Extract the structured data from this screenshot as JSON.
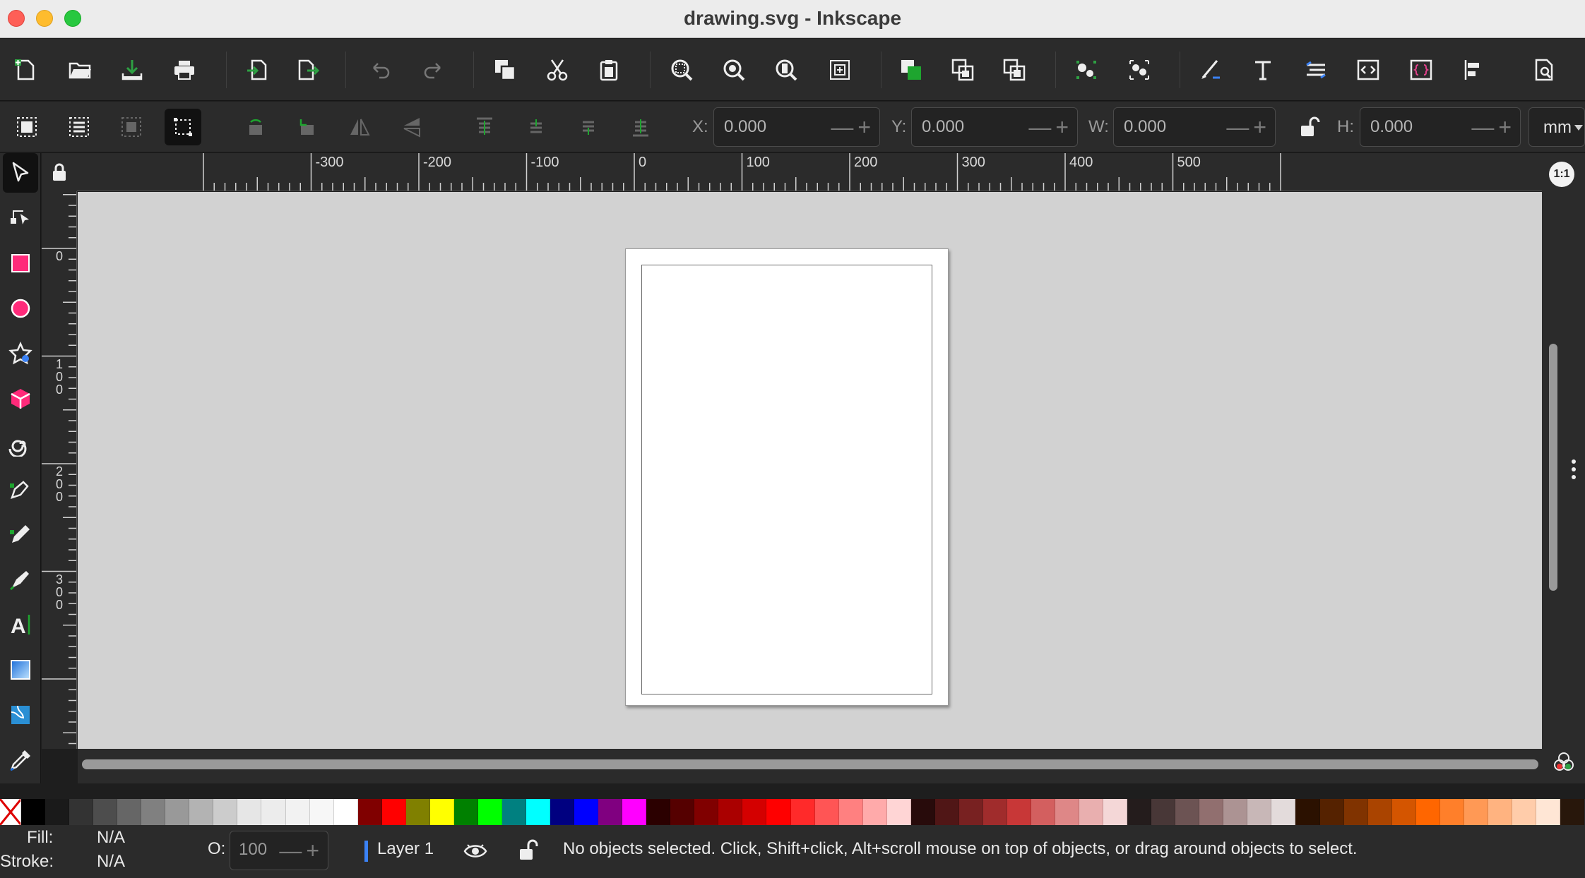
{
  "window": {
    "title": "drawing.svg - Inkscape"
  },
  "commands": [
    "new-document-icon",
    "open-document-icon",
    "save-document-icon",
    "print-icon",
    "import-icon",
    "export-icon",
    "undo-icon",
    "redo-icon",
    "duplicate-icon",
    "cut-icon",
    "paste-icon",
    "zoom-selection-icon",
    "zoom-drawing-icon",
    "zoom-page-icon",
    "zoom-page-width-icon",
    "raise-icon",
    "group-icon",
    "ungroup-icon",
    "clone-icon",
    "unlink-clone-icon",
    "fill-stroke-icon",
    "text-font-icon",
    "layers-icon",
    "xml-editor-icon",
    "object-properties-icon",
    "align-distribute-icon",
    "document-properties-icon"
  ],
  "toolcontrols": {
    "x": {
      "label": "X:",
      "value": "0.000"
    },
    "y": {
      "label": "Y:",
      "value": "0.000"
    },
    "w": {
      "label": "W:",
      "value": "0.000"
    },
    "h": {
      "label": "H:",
      "value": "0.000"
    },
    "unit": "mm"
  },
  "tools": [
    "selector-tool-icon",
    "node-tool-icon",
    "rectangle-tool-icon",
    "ellipse-tool-icon",
    "star-tool-icon",
    "3d-box-tool-icon",
    "spiral-tool-icon",
    "pen-tool-icon",
    "pencil-tool-icon",
    "calligraphy-tool-icon",
    "text-tool-icon",
    "gradient-tool-icon",
    "mesh-tool-icon",
    "dropper-tool-icon"
  ],
  "hruler": {
    "labels": [
      "-300",
      "-200",
      "-100",
      "0",
      "100",
      "200",
      "300",
      "400",
      "500"
    ]
  },
  "vruler": {
    "labels": [
      "0",
      "1\n0\n0",
      "2\n0\n0",
      "3\n0\n0"
    ]
  },
  "zoom_badge": "1:1",
  "palette": {
    "none_label": "none",
    "colors": [
      "#000000",
      "#1a1a1a",
      "#333333",
      "#4d4d4d",
      "#666666",
      "#808080",
      "#999999",
      "#b3b3b3",
      "#cccccc",
      "#e6e6e6",
      "#ececec",
      "#f2f2f2",
      "#f7f7f7",
      "#ffffff",
      "#800000",
      "#ff0000",
      "#808000",
      "#ffff00",
      "#008000",
      "#00ff00",
      "#008080",
      "#00ffff",
      "#000080",
      "#0000ff",
      "#800080",
      "#ff00ff",
      "#2b0000",
      "#550000",
      "#800000",
      "#aa0000",
      "#d40000",
      "#ff0000",
      "#ff2a2a",
      "#ff5555",
      "#ff8080",
      "#ffaaaa",
      "#ffd5d5",
      "#280b0b",
      "#501616",
      "#782121",
      "#a02c2c",
      "#c83737",
      "#d35f5f",
      "#de8787",
      "#e9afaf",
      "#f4d7d7",
      "#241c1c",
      "#483737",
      "#6c5353",
      "#916f6f",
      "#ac9393",
      "#c8b7b7",
      "#e3dbdb",
      "#2b1100",
      "#552200",
      "#803300",
      "#aa4400",
      "#d45500",
      "#ff6600",
      "#ff7f2a",
      "#ff9955",
      "#ffb380",
      "#ffccaa",
      "#ffe6d5",
      "#28170b"
    ]
  },
  "status": {
    "fill_label": "Fill:",
    "fill_value": "N/A",
    "stroke_label": "Stroke:",
    "stroke_value": "N/A",
    "opacity_label": "O:",
    "opacity_value": "100",
    "layer_name": "Layer 1",
    "message": "No objects selected. Click, Shift+click, Alt+scroll mouse on top of objects, or drag around objects to select."
  }
}
